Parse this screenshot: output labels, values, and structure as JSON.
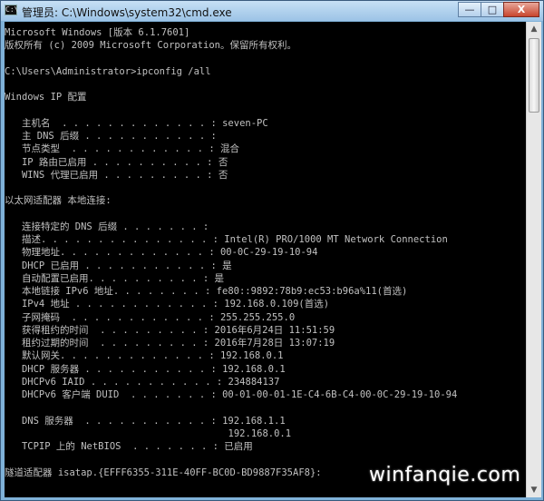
{
  "window": {
    "title": "管理员: C:\\Windows\\system32\\cmd.exe",
    "icon_text": "C:\\",
    "controls": {
      "minimize": "—",
      "maximize": "□",
      "close": "X"
    }
  },
  "console_lines": [
    "Microsoft Windows [版本 6.1.7601]",
    "版权所有 (c) 2009 Microsoft Corporation。保留所有权利。",
    "",
    "C:\\Users\\Administrator>ipconfig /all",
    "",
    "Windows IP 配置",
    "",
    "   主机名  . . . . . . . . . . . . . : seven-PC",
    "   主 DNS 后缀 . . . . . . . . . . . :",
    "   节点类型  . . . . . . . . . . . . : 混合",
    "   IP 路由已启用 . . . . . . . . . . : 否",
    "   WINS 代理已启用 . . . . . . . . . : 否",
    "",
    "以太网适配器 本地连接:",
    "",
    "   连接特定的 DNS 后缀 . . . . . . . :",
    "   描述. . . . . . . . . . . . . . . : Intel(R) PRO/1000 MT Network Connection",
    "   物理地址. . . . . . . . . . . . . : 00-0C-29-19-10-94",
    "   DHCP 已启用 . . . . . . . . . . . : 是",
    "   自动配置已启用. . . . . . . . . . : 是",
    "   本地链接 IPv6 地址. . . . . . . . : fe80::9892:78b9:ec53:b96a%11(首选)",
    "   IPv4 地址 . . . . . . . . . . . . : 192.168.0.109(首选)",
    "   子网掩码  . . . . . . . . . . . . : 255.255.255.0",
    "   获得租约的时间  . . . . . . . . . : 2016年6月24日 11:51:59",
    "   租约过期的时间  . . . . . . . . . : 2016年7月28日 13:07:19",
    "   默认网关. . . . . . . . . . . . . : 192.168.0.1",
    "   DHCP 服务器 . . . . . . . . . . . : 192.168.0.1",
    "   DHCPv6 IAID . . . . . . . . . . . : 234884137",
    "   DHCPv6 客户端 DUID  . . . . . . . : 00-01-00-01-1E-C4-6B-C4-00-0C-29-19-10-94",
    "",
    "   DNS 服务器  . . . . . . . . . . . : 192.168.1.1",
    "                                       192.168.0.1",
    "   TCPIP 上的 NetBIOS  . . . . . . . : 已启用",
    "",
    "隧道适配器 isatap.{EFFF6355-311E-40FF-BC0D-BD9887F35AF8}:"
  ],
  "watermark": "winfanqie.com",
  "colors": {
    "console_bg": "#000000",
    "console_fg": "#c0c0c0",
    "title_bar": "#9cc3e6",
    "close_button": "#c8452d"
  }
}
